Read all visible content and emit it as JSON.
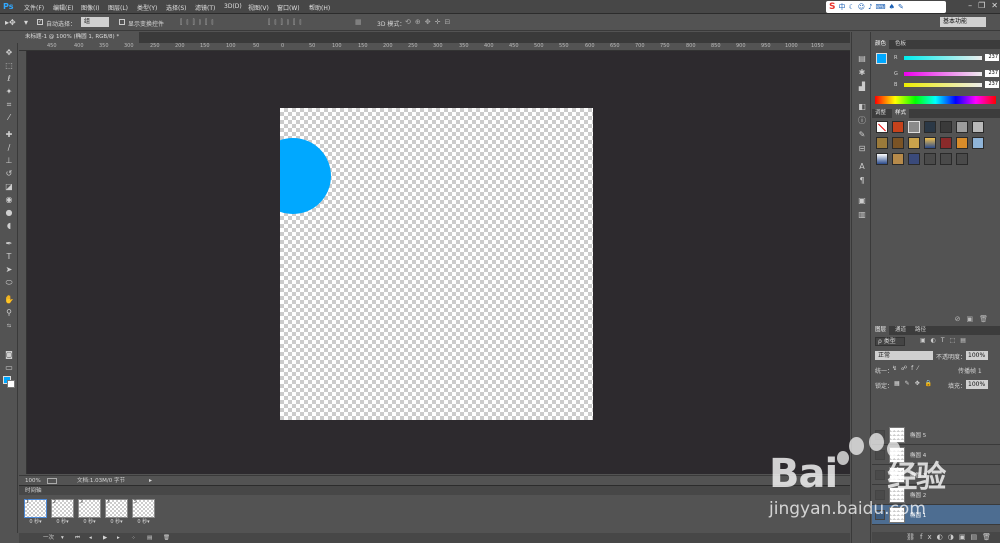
{
  "app": {
    "logo": "Ps"
  },
  "menu": [
    "文件(F)",
    "编辑(E)",
    "图像(I)",
    "图层(L)",
    "类型(Y)",
    "选择(S)",
    "滤镜(T)",
    "3D(D)",
    "视图(V)",
    "窗口(W)",
    "帮助(H)"
  ],
  "ime": {
    "logo": "S",
    "lang": "中",
    "icons": [
      "moon-icon",
      "smile-icon",
      "mic-icon",
      "keyboard-icon",
      "shirt-icon",
      "wrench-icon"
    ]
  },
  "options_bar": {
    "auto_select_label": "自动选择：",
    "auto_select_value": "组",
    "show_transform_label": "显示变换控件",
    "mode_3d_label": "3D 模式：",
    "workspace_preset": "基本功能"
  },
  "document": {
    "tab_title": "未标题-1 @ 100% (椭圆 1, RGB/8) *",
    "ruler_ticks": [
      "450",
      "400",
      "350",
      "300",
      "250",
      "200",
      "150",
      "100",
      "50",
      "0",
      "50",
      "100",
      "150",
      "200",
      "250",
      "300",
      "350",
      "400",
      "450",
      "500",
      "550",
      "600",
      "650",
      "700",
      "750",
      "800",
      "850",
      "900",
      "950",
      "1000",
      "1050"
    ]
  },
  "canvas": {
    "shape_color": "#00a8ff",
    "background": "transparent"
  },
  "status": {
    "zoom": "100%",
    "doc_info": "文档:1.03M/0 字节"
  },
  "timeline": {
    "title": "时间轴",
    "frames": [
      {
        "number": "1",
        "delay": "0 秒▾"
      },
      {
        "number": "2",
        "delay": "0 秒▾"
      },
      {
        "number": "3",
        "delay": "0 秒▾"
      },
      {
        "number": "4",
        "delay": "0 秒▾"
      },
      {
        "number": "5",
        "delay": "0 秒▾"
      }
    ],
    "loop": "一次"
  },
  "color_panel": {
    "tabs": [
      "颜色",
      "色板"
    ],
    "channels": [
      {
        "label": "R",
        "value": "237"
      },
      {
        "label": "G",
        "value": "237"
      },
      {
        "label": "B",
        "value": "237"
      }
    ],
    "fg_color": "#00a8ff",
    "bg_color": "#ffffff"
  },
  "styles_panel": {
    "tabs": [
      "调整",
      "样式"
    ]
  },
  "layers_panel": {
    "tabs": [
      "图层",
      "通道",
      "路径"
    ],
    "filter_kind": "ρ 类型",
    "blend_mode": "正常",
    "opacity_label": "不透明度：",
    "opacity_value": "100%",
    "unify_label": "统一：",
    "propagate_label": "传播帧 1",
    "lock_label": "锁定：",
    "fill_label": "填充：",
    "fill_value": "100%",
    "layers": [
      {
        "name": "椭圆 5",
        "selected": false
      },
      {
        "name": "椭圆 4",
        "selected": false
      },
      {
        "name": "椭圆 3",
        "selected": false
      },
      {
        "name": "椭圆 2",
        "selected": false
      },
      {
        "name": "椭圆 1",
        "selected": true
      }
    ]
  },
  "watermark": {
    "brand": "Bai",
    "brand2": "经验",
    "url": "jingyan.baidu.com"
  }
}
